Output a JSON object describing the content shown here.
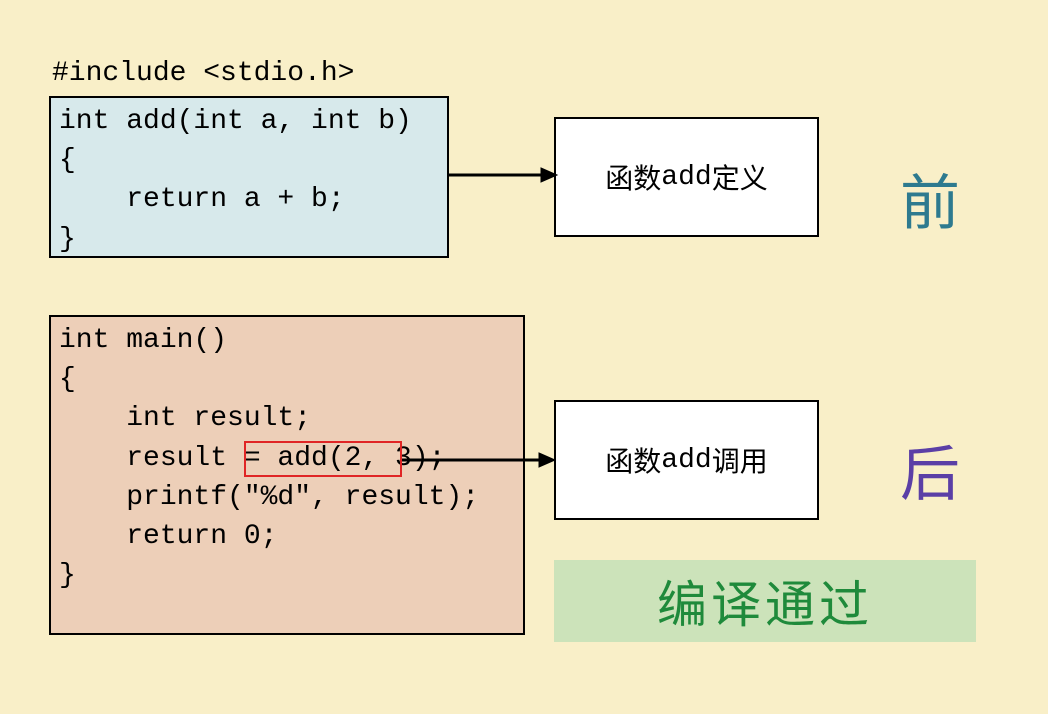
{
  "include": "#include <stdio.h>",
  "codeAdd": "int add(int a, int b)\n{\n    return a + b;\n}",
  "codeMain": "int main()\n{\n    int result;\n    result = add(2, 3);\n    printf(\"%d\", result);\n    return 0;\n}",
  "labelDefPrefix": "函数",
  "labelDefMono": "add",
  "labelDefSuffix": "定义",
  "labelCallPrefix": "函数",
  "labelCallMono": "add",
  "labelCallSuffix": "调用",
  "charBefore": "前",
  "charAfter": "后",
  "compilePass": "编译通过"
}
